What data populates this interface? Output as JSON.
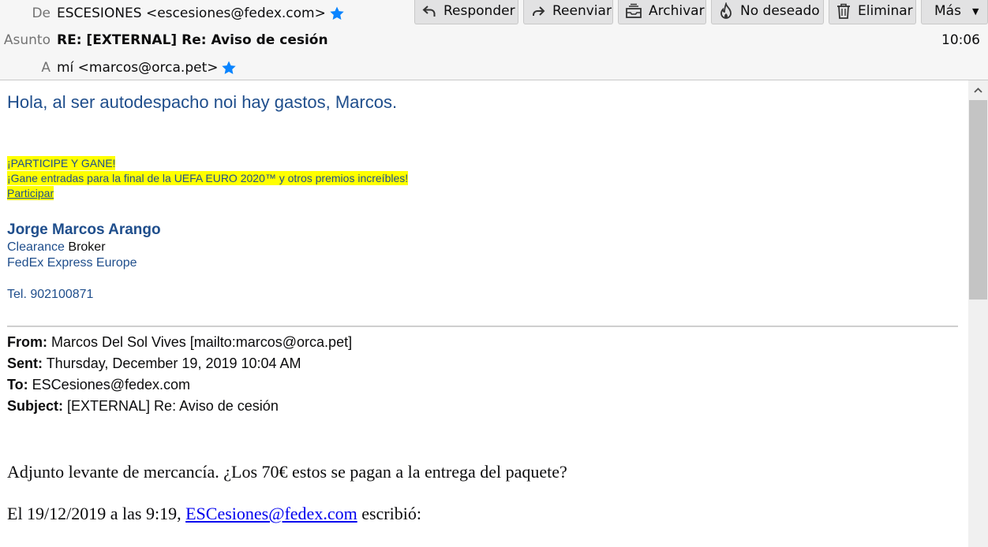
{
  "header": {
    "from_label": "De",
    "from_value": "ESCESIONES <escesiones@fedex.com>",
    "subject_label": "Asunto",
    "subject_value": "RE: [EXTERNAL] Re: Aviso de cesión",
    "to_label": "A",
    "to_value": "mí <marcos@orca.pet>",
    "time": "10:06",
    "star_color": "#0a84ff"
  },
  "toolbar": {
    "reply": "Responder",
    "forward": "Reenviar",
    "archive": "Archivar",
    "junk": "No deseado",
    "delete": "Eliminar",
    "more": "Más"
  },
  "body": {
    "greeting": "Hola, al ser autodespacho noi hay gastos, Marcos.",
    "promo": {
      "line1": "¡PARTICIPE Y GANE!",
      "line2": "¡Gane entradas para la final de la UEFA EURO 2020™ y otros premios increíbles!",
      "link": "Participar",
      "highlight_color": "#ffff00"
    },
    "signature": {
      "name": "Jorge Marcos Arango",
      "title_part1": "Clearance",
      "title_part2": "Broker",
      "company": "FedEx Express Europe",
      "phone": "Tel. 902100871",
      "color": "#1f4e8c"
    },
    "quoted_header": {
      "from_label": "From:",
      "from_value": "Marcos Del Sol Vives [mailto:marcos@orca.pet]",
      "sent_label": "Sent:",
      "sent_value": "Thursday, December 19, 2019 10:04 AM",
      "to_label": "To:",
      "to_value": "ESCesiones@fedex.com",
      "subject_label": "Subject:",
      "subject_value": "[EXTERNAL] Re: Aviso de cesión"
    },
    "quoted_text": "Adjunto levante de mercancía. ¿Los 70€ estos se pagan a la entrega del paquete?",
    "attribution_prefix": "El 19/12/2019 a las 9:19,",
    "attribution_link": "ESCesiones@fedex.com",
    "attribution_suffix": "escribió:"
  }
}
